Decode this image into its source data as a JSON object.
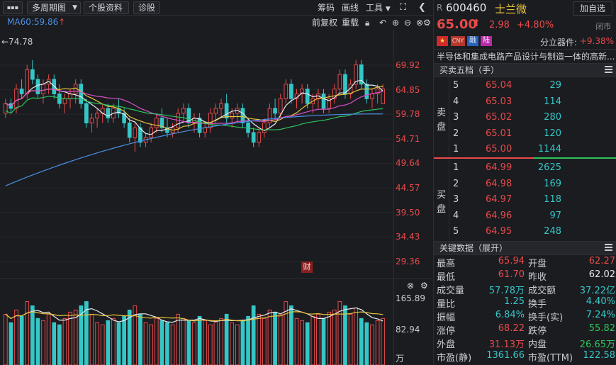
{
  "toolbar": {
    "menu_label": "▪▪▪",
    "period_label": "多周期图",
    "profile_label": "个股资料",
    "diagnose_label": "诊股",
    "chips_label": "筹码",
    "draw_label": "画线",
    "tools_label": "工具"
  },
  "indicator_row": {
    "ma60": "MA60:59.86",
    "adjust_label": "前复权",
    "redraw_label": "重载"
  },
  "price_axis": {
    "high_marker": "←74.78",
    "ticks": [
      "69.92",
      "64.85",
      "59.78",
      "54.71",
      "49.64",
      "44.57",
      "39.50",
      "34.43",
      "29.36"
    ]
  },
  "volume_axis": {
    "ticks": [
      "165.89",
      "82.94"
    ],
    "unit": "万"
  },
  "finance_badge": "财",
  "stock": {
    "market_letter": "R",
    "code": "600460",
    "name": "士兰微",
    "add_button": "加自选",
    "price": "65.00",
    "change": "2.98",
    "change_pct": "+4.80%",
    "status": "闭市",
    "badges": [
      "CNY",
      "融",
      "陆"
    ],
    "sector_label": "分立器件:",
    "sector_change": "+9.38%",
    "description": "半导体和集成电路产品设计与制造一体的高新..."
  },
  "order_book": {
    "title": "买卖五档（手）",
    "sell_label": [
      "卖",
      "盘"
    ],
    "buy_label": [
      "买",
      "盘"
    ],
    "asks": [
      {
        "level": "5",
        "price": "65.04",
        "volume": "29"
      },
      {
        "level": "4",
        "price": "65.03",
        "volume": "114"
      },
      {
        "level": "3",
        "price": "65.02",
        "volume": "280"
      },
      {
        "level": "2",
        "price": "65.01",
        "volume": "120"
      },
      {
        "level": "1",
        "price": "65.00",
        "volume": "1144"
      }
    ],
    "bids": [
      {
        "level": "1",
        "price": "64.99",
        "volume": "2625"
      },
      {
        "level": "2",
        "price": "64.98",
        "volume": "169"
      },
      {
        "level": "3",
        "price": "64.97",
        "volume": "118"
      },
      {
        "level": "4",
        "price": "64.96",
        "volume": "97"
      },
      {
        "level": "5",
        "price": "64.95",
        "volume": "248"
      }
    ]
  },
  "key_data": {
    "title": "关键数据（展开）",
    "rows": [
      {
        "l1": "最高",
        "v1": "65.94",
        "c1": "red",
        "l2": "开盘",
        "v2": "62.27",
        "c2": "red"
      },
      {
        "l1": "最低",
        "v1": "61.70",
        "c1": "red",
        "l2": "昨收",
        "v2": "62.02",
        "c2": "white"
      },
      {
        "l1": "成交量",
        "v1": "57.78万",
        "c1": "cyan",
        "l2": "成交额",
        "v2": "37.22亿",
        "c2": "cyan"
      },
      {
        "l1": "量比",
        "v1": "1.25",
        "c1": "cyan",
        "l2": "换手",
        "v2": "4.40%",
        "c2": "cyan"
      },
      {
        "l1": "振幅",
        "v1": "6.84%",
        "c1": "cyan",
        "l2": "换手(实)",
        "v2": "7.24%",
        "c2": "cyan"
      },
      {
        "l1": "涨停",
        "v1": "68.22",
        "c1": "red",
        "l2": "跌停",
        "v2": "55.82",
        "c2": "green"
      },
      {
        "l1": "外盘",
        "v1": "31.13万",
        "c1": "red",
        "l2": "内盘",
        "v2": "26.65万",
        "c2": "green"
      },
      {
        "l1": "市盈(静)",
        "v1": "1361.66",
        "c1": "cyan",
        "l2": "市盈(TTM)",
        "v2": "122.58",
        "c2": "cyan"
      }
    ]
  },
  "colors": {
    "up": "#e84a4a",
    "down": "#35c6c6",
    "ma5": "#e8eaee",
    "ma10": "#e8c33a",
    "ma20": "#d64fc8",
    "ma30": "#2ec35a",
    "ma60": "#4a90e2"
  },
  "chart_data": {
    "type": "candlestick",
    "ylim": [
      29.36,
      74.78
    ],
    "candles": [
      [
        60,
        63,
        59,
        62
      ],
      [
        62,
        63,
        60,
        61
      ],
      [
        61,
        66,
        60,
        65
      ],
      [
        65,
        67,
        63,
        64
      ],
      [
        64,
        70,
        63,
        69
      ],
      [
        69,
        71,
        66,
        67
      ],
      [
        67,
        68,
        63,
        64
      ],
      [
        64,
        67,
        62,
        66
      ],
      [
        66,
        68,
        64,
        67
      ],
      [
        67,
        68,
        63,
        64
      ],
      [
        64,
        66,
        61,
        62
      ],
      [
        62,
        64,
        60,
        63
      ],
      [
        63,
        65,
        61,
        64
      ],
      [
        64,
        67,
        62,
        66
      ],
      [
        66,
        67,
        61,
        62
      ],
      [
        62,
        63,
        57,
        58
      ],
      [
        58,
        60,
        56,
        59
      ],
      [
        59,
        61,
        57,
        60
      ],
      [
        60,
        62,
        58,
        61
      ],
      [
        61,
        62,
        58,
        59
      ],
      [
        59,
        62,
        58,
        61
      ],
      [
        61,
        63,
        59,
        60
      ],
      [
        60,
        61,
        57,
        58
      ],
      [
        58,
        59,
        54,
        55
      ],
      [
        55,
        58,
        52,
        57
      ],
      [
        57,
        58,
        53,
        54
      ],
      [
        54,
        56,
        53,
        55
      ],
      [
        55,
        58,
        54,
        57
      ],
      [
        57,
        60,
        56,
        59
      ],
      [
        59,
        61,
        56,
        57
      ],
      [
        57,
        59,
        55,
        56
      ],
      [
        56,
        58,
        55,
        57
      ],
      [
        57,
        61,
        56,
        60
      ],
      [
        60,
        62,
        58,
        61
      ],
      [
        61,
        62,
        57,
        58
      ],
      [
        58,
        60,
        56,
        59
      ],
      [
        59,
        60,
        55,
        56
      ],
      [
        56,
        58,
        55,
        57
      ],
      [
        57,
        61,
        56,
        60
      ],
      [
        60,
        62,
        58,
        61
      ],
      [
        61,
        63,
        59,
        62
      ],
      [
        62,
        64,
        58,
        59
      ],
      [
        59,
        61,
        57,
        60
      ],
      [
        60,
        62,
        58,
        61
      ],
      [
        61,
        62,
        57,
        58
      ],
      [
        58,
        59,
        55,
        56
      ],
      [
        56,
        57,
        53,
        54
      ],
      [
        54,
        57,
        53,
        56
      ],
      [
        56,
        59,
        55,
        58
      ],
      [
        58,
        62,
        57,
        61
      ],
      [
        61,
        63,
        59,
        60
      ],
      [
        60,
        64,
        59,
        63
      ],
      [
        63,
        67,
        62,
        66
      ],
      [
        66,
        67,
        62,
        63
      ],
      [
        63,
        65,
        61,
        64
      ],
      [
        64,
        66,
        62,
        65
      ],
      [
        65,
        66,
        61,
        62
      ],
      [
        62,
        64,
        60,
        63
      ],
      [
        63,
        65,
        61,
        64
      ],
      [
        64,
        65,
        60,
        61
      ],
      [
        61,
        64,
        60,
        63
      ],
      [
        63,
        66,
        62,
        65
      ],
      [
        65,
        69,
        64,
        68
      ],
      [
        68,
        69,
        63,
        64
      ],
      [
        64,
        67,
        63,
        66
      ],
      [
        66,
        71,
        65,
        70
      ],
      [
        70,
        71,
        65,
        66
      ],
      [
        66,
        67,
        62,
        63
      ],
      [
        63,
        65,
        61,
        64
      ],
      [
        64,
        66,
        62,
        65
      ],
      [
        62,
        66,
        62,
        65
      ]
    ],
    "ma_series": [
      {
        "name": "MA60",
        "value": 59.86
      }
    ],
    "volume": [
      120,
      100,
      130,
      115,
      150,
      140,
      110,
      105,
      120,
      100,
      95,
      110,
      125,
      130,
      140,
      150,
      120,
      100,
      95,
      105,
      110,
      100,
      115,
      130,
      140,
      120,
      100,
      95,
      110,
      105,
      100,
      95,
      120,
      110,
      105,
      100,
      115,
      105,
      95,
      100,
      110,
      120,
      100,
      95,
      105,
      115,
      140,
      120,
      110,
      130,
      125,
      120,
      150,
      140,
      110,
      105,
      100,
      115,
      120,
      110,
      125,
      130,
      150,
      140,
      120,
      135,
      110,
      100,
      95,
      105,
      110
    ],
    "volume_ylim": [
      0,
      165.89
    ]
  }
}
